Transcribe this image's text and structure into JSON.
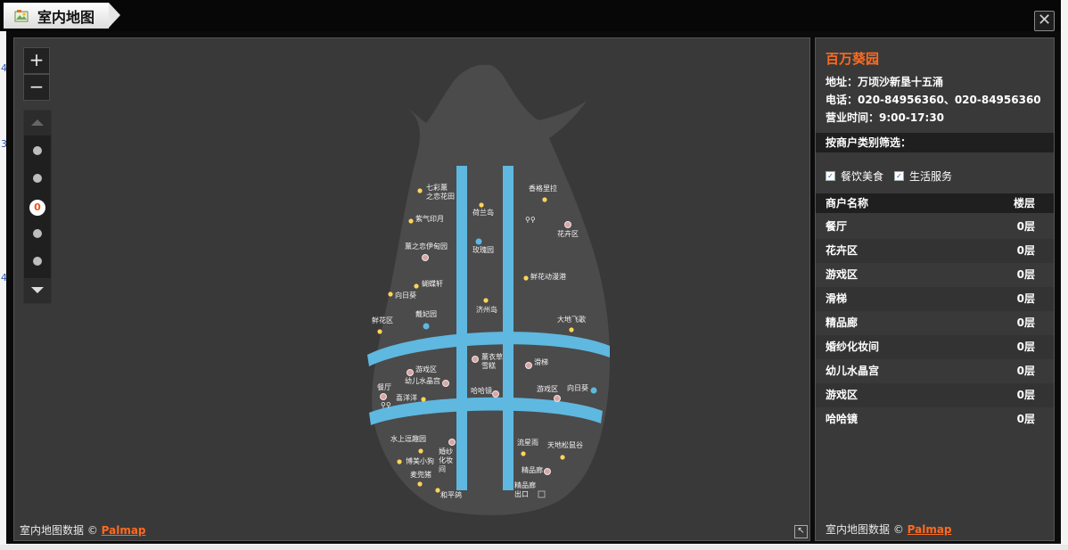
{
  "window": {
    "title": "室内地图",
    "close_label": "✕"
  },
  "icons": {
    "title": "map-icon",
    "close": "close-icon",
    "zoom_in": "plus-icon",
    "zoom_out": "minus-icon",
    "expand": "expand-icon",
    "checkbox": "check-icon"
  },
  "colors": {
    "accent": "#ff6a1f",
    "corridor": "#5fb8e0",
    "floor_plan": "#4b4b4b",
    "panel": "#393939",
    "frame": "#0b0b0b"
  },
  "map": {
    "zoom_in_label": "+",
    "zoom_out_label": "−",
    "current_floor": "0",
    "credit_prefix": "室内地图数据 © ",
    "credit_link": "Palmap",
    "places": [
      {
        "name": "七彩薰\n之恋花田",
        "kind": "yellow"
      },
      {
        "name": "荷兰岛",
        "kind": "yellow"
      },
      {
        "name": "香格里拉",
        "kind": "yellow"
      },
      {
        "name": "紫气印月",
        "kind": "yellow"
      },
      {
        "name": "花卉区",
        "kind": "pink"
      },
      {
        "name": "薰之恋伊甸园",
        "kind": "pink"
      },
      {
        "name": "玫瑰园",
        "kind": "blue"
      },
      {
        "name": "蝴蝶轩",
        "kind": "yellow"
      },
      {
        "name": "鲜花动漫港",
        "kind": "yellow"
      },
      {
        "name": "向日葵",
        "kind": "yellow"
      },
      {
        "name": "济州岛",
        "kind": "yellow"
      },
      {
        "name": "鲜花区",
        "kind": "yellow"
      },
      {
        "name": "戴妃园",
        "kind": "blue"
      },
      {
        "name": "大地飞歌",
        "kind": "yellow"
      },
      {
        "name": "薰衣草\n雪糕",
        "kind": "pink"
      },
      {
        "name": "滑梯",
        "kind": "pink"
      },
      {
        "name": "游戏区",
        "kind": "pink"
      },
      {
        "name": "幼儿水晶宫",
        "kind": "pink"
      },
      {
        "name": "餐厅",
        "kind": "pink"
      },
      {
        "name": "喜洋洋",
        "kind": "yellow"
      },
      {
        "name": "哈哈镜",
        "kind": "pink"
      },
      {
        "name": "游戏区",
        "kind": "pink"
      },
      {
        "name": "向日葵",
        "kind": "blue"
      },
      {
        "name": "水上逗趣园",
        "kind": "yellow"
      },
      {
        "name": "婚纱\n化妆\n间",
        "kind": "pink"
      },
      {
        "name": "流星雨",
        "kind": "yellow"
      },
      {
        "name": "天地松鼠谷",
        "kind": "yellow"
      },
      {
        "name": "博美小狗",
        "kind": "yellow"
      },
      {
        "name": "麦兜猪",
        "kind": "yellow"
      },
      {
        "name": "精品廊",
        "kind": "pink"
      },
      {
        "name": "和平鸽",
        "kind": "yellow"
      },
      {
        "name": "精品廊\n出口",
        "kind": "exit"
      }
    ]
  },
  "info": {
    "store_name": "百万葵园",
    "address": "地址：万顷沙新垦十五涌",
    "phone": "电话：020-84956360、020-84956360",
    "hours": "营业时间：9:00-17:30",
    "filter_heading": "按商户类别筛选：",
    "filters": [
      "餐饮美食",
      "生活服务"
    ],
    "table_headers": {
      "name": "商户名称",
      "floor": "楼层"
    },
    "rows": [
      {
        "name": "餐厅",
        "floor": "0层"
      },
      {
        "name": "花卉区",
        "floor": "0层"
      },
      {
        "name": "游戏区",
        "floor": "0层"
      },
      {
        "name": "滑梯",
        "floor": "0层"
      },
      {
        "name": "精品廊",
        "floor": "0层"
      },
      {
        "name": "婚纱化妆间",
        "floor": "0层"
      },
      {
        "name": "幼儿水晶宫",
        "floor": "0层"
      },
      {
        "name": "游戏区",
        "floor": "0层"
      },
      {
        "name": "哈哈镜",
        "floor": "0层"
      }
    ],
    "credit_prefix": "室内地图数据 © ",
    "credit_link": "Palmap"
  }
}
